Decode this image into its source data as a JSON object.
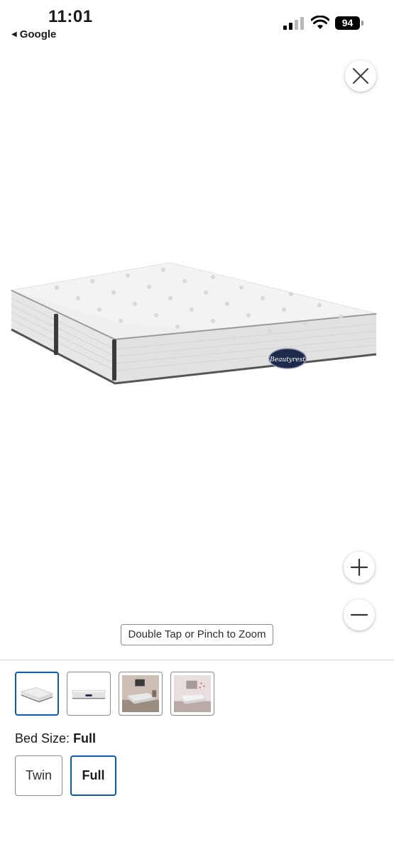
{
  "status_bar": {
    "time": "11:01",
    "back_app": "Google",
    "battery_level": "94"
  },
  "viewer": {
    "close_icon": "close-icon",
    "zoom_hint": "Double Tap or Pinch to Zoom",
    "zoom_in_icon": "plus-icon",
    "zoom_out_icon": "minus-icon",
    "brand_badge": "Beautyrest"
  },
  "thumbnails": [
    {
      "label": "mattress-angle",
      "selected": true
    },
    {
      "label": "mattress-side",
      "selected": false
    },
    {
      "label": "bedroom-scene-1",
      "selected": false
    },
    {
      "label": "bedroom-scene-2",
      "selected": false
    }
  ],
  "bed_size": {
    "label": "Bed Size:",
    "selected_value": "Full",
    "options": [
      {
        "label": "Twin",
        "selected": false
      },
      {
        "label": "Full",
        "selected": true
      }
    ]
  },
  "colors": {
    "accent": "#0b5cad",
    "border": "#8a8a8a"
  }
}
